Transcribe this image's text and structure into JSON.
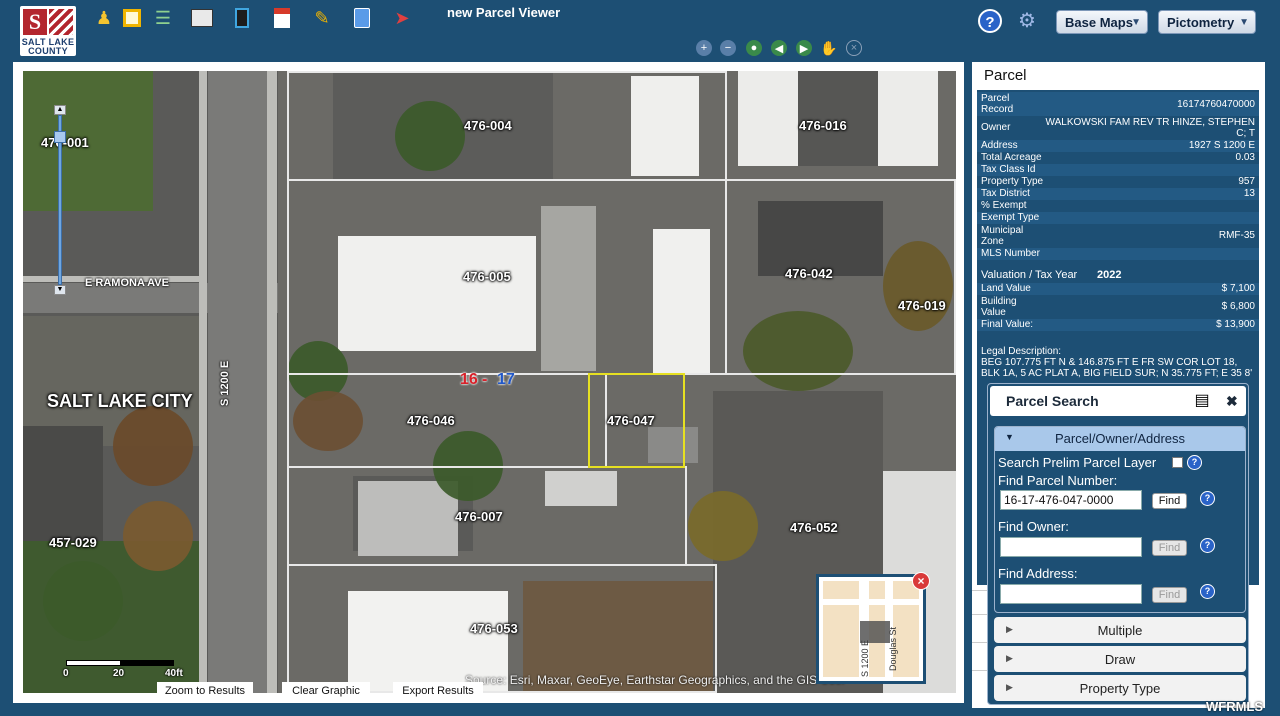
{
  "logo": {
    "line1": "SALT LAKE",
    "line2": "COUNTY"
  },
  "app_title": "new Parcel Viewer",
  "toolbar": {
    "help_label": "?",
    "base_maps_label": "Base Maps",
    "pictometry_label": "Pictometry"
  },
  "map": {
    "parcel_labels": [
      "476-001",
      "476-004",
      "476-016",
      "476-005",
      "476-042",
      "476-019",
      "476-046",
      "476-047",
      "476-007",
      "476-052",
      "457-029",
      "476-053"
    ],
    "streets": {
      "ramona": "E RAMONA AVE",
      "s1200e": "S 1200 E"
    },
    "city": "SALT LAKE CITY",
    "section_a": "16",
    "section_sep": "-",
    "section_b": "17",
    "scale": {
      "t0": "0",
      "t1": "20",
      "t2": "40ft"
    },
    "buttons": {
      "zoom": "Zoom to Results",
      "clear": "Clear Graphic",
      "export": "Export Results"
    },
    "source": "Source: Esri, Maxar, GeoEye, Earthstar Geographics, and the GIS User",
    "overview": {
      "street1": "S 1200 E",
      "street2": "Douglas St"
    }
  },
  "parcel_panel": {
    "title": "Parcel",
    "rows": [
      {
        "k": "Parcel Record",
        "v": "16174760470000"
      },
      {
        "k": "Owner",
        "v": "WALKOWSKI FAM REV TR HINZE, STEPHEN C; T"
      },
      {
        "k": "Address",
        "v": "1927 S 1200 E"
      },
      {
        "k": "Total Acreage",
        "v": "0.03"
      },
      {
        "k": "Tax Class Id",
        "v": ""
      },
      {
        "k": "Property Type",
        "v": "957"
      },
      {
        "k": "Tax District",
        "v": "13"
      },
      {
        "k": "% Exempt",
        "v": ""
      },
      {
        "k": "Exempt Type",
        "v": ""
      },
      {
        "k": "Municipal Zone",
        "v": "RMF-35"
      },
      {
        "k": "MLS Number",
        "v": ""
      }
    ],
    "valuation_label": "Valuation / Tax Year",
    "valuation_year": "2022",
    "values": [
      {
        "k": "Land Value",
        "v": "$ 7,100"
      },
      {
        "k": "Building Value",
        "v": "$ 6,800"
      },
      {
        "k": "Final Value:",
        "v": "$ 13,900"
      }
    ],
    "legal_label": "Legal Description:",
    "legal_text": "BEG 107.775 FT N & 146.875 FT E FR SW COR LOT 18, BLK 1A, 5 AC PLAT A, BIG FIELD SUR; N 35.775 FT; E 35 8'"
  },
  "parcel_search": {
    "title": "Parcel Search",
    "close": "✖",
    "section_open": "Parcel/Owner/Address",
    "prelim_label": "Search Prelim Parcel Layer",
    "find_parcel_label": "Find Parcel Number:",
    "find_parcel_value": "16-17-476-047-0000",
    "find_owner_label": "Find Owner:",
    "find_owner_value": "",
    "find_address_label": "Find Address:",
    "find_address_value": "",
    "find_btn": "Find",
    "sections": [
      "Multiple",
      "Draw",
      "Property Type"
    ]
  },
  "watermark": "WFRMLS"
}
